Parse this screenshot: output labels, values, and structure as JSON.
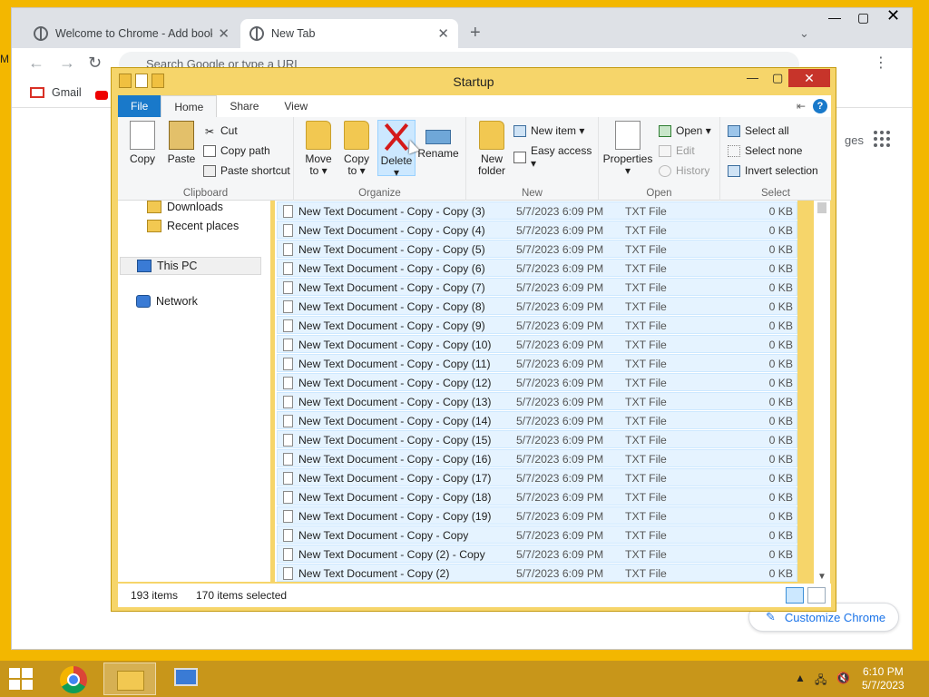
{
  "chrome": {
    "tabs": [
      {
        "title": "Welcome to Chrome - Add book"
      },
      {
        "title": "New Tab"
      }
    ],
    "omnibox_placeholder": "Search Google or type a URL",
    "bookmarks": [
      {
        "label": "Gmail"
      }
    ],
    "partial_text": "ges",
    "customize_label": "Customize Chrome"
  },
  "explorer": {
    "title": "Startup",
    "ribbon_tabs": [
      "File",
      "Home",
      "Share",
      "View"
    ],
    "clipboard": {
      "group_label": "Clipboard",
      "copy": "Copy",
      "paste": "Paste",
      "cut": "Cut",
      "copy_path": "Copy path",
      "paste_shortcut": "Paste shortcut"
    },
    "organize": {
      "group_label": "Organize",
      "move_to": [
        "Move",
        "to ▾"
      ],
      "copy_to": [
        "Copy",
        "to ▾"
      ],
      "delete": [
        "Delete",
        "▾"
      ],
      "rename": "Rename"
    },
    "new": {
      "group_label": "New",
      "new_item": "New item ▾",
      "easy_access": "Easy access ▾",
      "new_folder": [
        "New",
        "folder"
      ]
    },
    "open": {
      "group_label": "Open",
      "properties": [
        "Properties",
        "▾"
      ],
      "open": "Open ▾",
      "edit": "Edit",
      "history": "History"
    },
    "select": {
      "group_label": "Select",
      "select_all": "Select all",
      "select_none": "Select none",
      "invert": "Invert selection"
    },
    "nav": [
      {
        "label": "Downloads"
      },
      {
        "label": "Recent places"
      },
      {
        "label": "This PC"
      },
      {
        "label": "Network"
      }
    ],
    "files": [
      {
        "name": "New Text Document - Copy - Copy (3)",
        "date": "5/7/2023 6:09 PM",
        "type": "TXT File",
        "size": "0 KB"
      },
      {
        "name": "New Text Document - Copy - Copy (4)",
        "date": "5/7/2023 6:09 PM",
        "type": "TXT File",
        "size": "0 KB"
      },
      {
        "name": "New Text Document - Copy - Copy (5)",
        "date": "5/7/2023 6:09 PM",
        "type": "TXT File",
        "size": "0 KB"
      },
      {
        "name": "New Text Document - Copy - Copy (6)",
        "date": "5/7/2023 6:09 PM",
        "type": "TXT File",
        "size": "0 KB"
      },
      {
        "name": "New Text Document - Copy - Copy (7)",
        "date": "5/7/2023 6:09 PM",
        "type": "TXT File",
        "size": "0 KB"
      },
      {
        "name": "New Text Document - Copy - Copy (8)",
        "date": "5/7/2023 6:09 PM",
        "type": "TXT File",
        "size": "0 KB"
      },
      {
        "name": "New Text Document - Copy - Copy (9)",
        "date": "5/7/2023 6:09 PM",
        "type": "TXT File",
        "size": "0 KB"
      },
      {
        "name": "New Text Document - Copy - Copy (10)",
        "date": "5/7/2023 6:09 PM",
        "type": "TXT File",
        "size": "0 KB"
      },
      {
        "name": "New Text Document - Copy - Copy (11)",
        "date": "5/7/2023 6:09 PM",
        "type": "TXT File",
        "size": "0 KB"
      },
      {
        "name": "New Text Document - Copy - Copy (12)",
        "date": "5/7/2023 6:09 PM",
        "type": "TXT File",
        "size": "0 KB"
      },
      {
        "name": "New Text Document - Copy - Copy (13)",
        "date": "5/7/2023 6:09 PM",
        "type": "TXT File",
        "size": "0 KB"
      },
      {
        "name": "New Text Document - Copy - Copy (14)",
        "date": "5/7/2023 6:09 PM",
        "type": "TXT File",
        "size": "0 KB"
      },
      {
        "name": "New Text Document - Copy - Copy (15)",
        "date": "5/7/2023 6:09 PM",
        "type": "TXT File",
        "size": "0 KB"
      },
      {
        "name": "New Text Document - Copy - Copy (16)",
        "date": "5/7/2023 6:09 PM",
        "type": "TXT File",
        "size": "0 KB"
      },
      {
        "name": "New Text Document - Copy - Copy (17)",
        "date": "5/7/2023 6:09 PM",
        "type": "TXT File",
        "size": "0 KB"
      },
      {
        "name": "New Text Document - Copy - Copy (18)",
        "date": "5/7/2023 6:09 PM",
        "type": "TXT File",
        "size": "0 KB"
      },
      {
        "name": "New Text Document - Copy - Copy (19)",
        "date": "5/7/2023 6:09 PM",
        "type": "TXT File",
        "size": "0 KB"
      },
      {
        "name": "New Text Document - Copy - Copy",
        "date": "5/7/2023 6:09 PM",
        "type": "TXT File",
        "size": "0 KB"
      },
      {
        "name": "New Text Document - Copy (2) - Copy",
        "date": "5/7/2023 6:09 PM",
        "type": "TXT File",
        "size": "0 KB"
      },
      {
        "name": "New Text Document - Copy (2)",
        "date": "5/7/2023 6:09 PM",
        "type": "TXT File",
        "size": "0 KB"
      }
    ],
    "status": {
      "items": "193 items",
      "selected": "170 items selected"
    }
  },
  "taskbar": {
    "time": "6:10 PM",
    "date": "5/7/2023"
  },
  "colors": {
    "desktop": "#f3b700",
    "taskbar": "#c8961a",
    "explorer_frame": "#f6d56a",
    "selection": "#e5f3ff",
    "file_tab": "#1979ca",
    "close_button": "#c7342a"
  }
}
